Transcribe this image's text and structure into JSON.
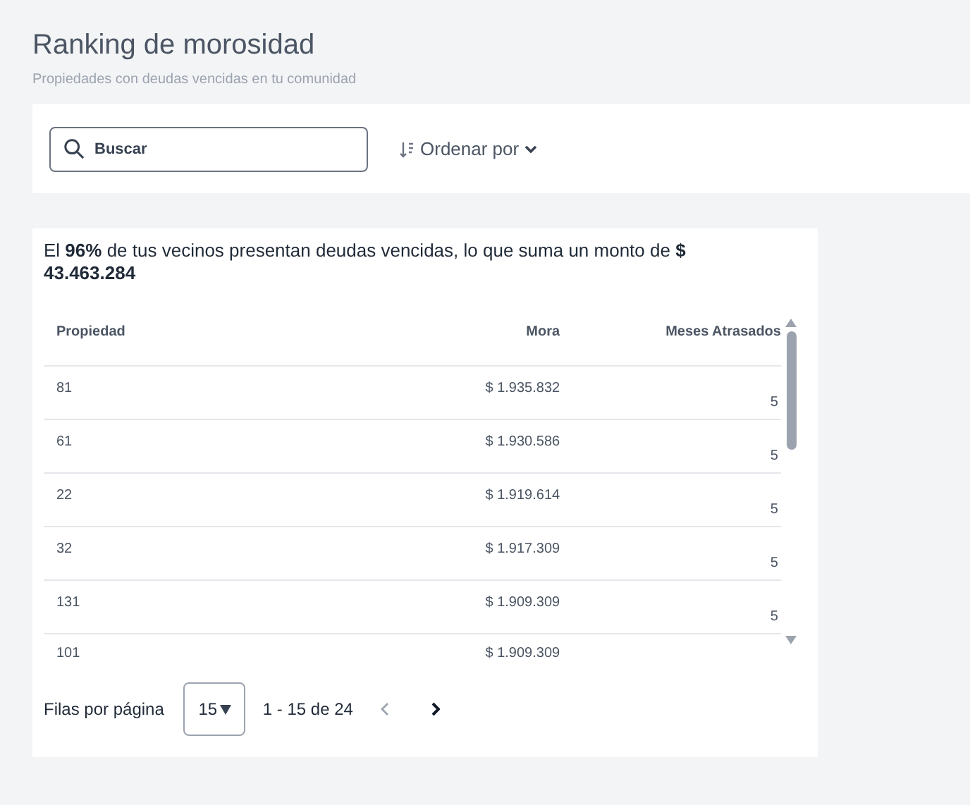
{
  "header": {
    "title": "Ranking de morosidad",
    "subtitle": "Propiedades con deudas vencidas en tu comunidad"
  },
  "toolbar": {
    "search": {
      "placeholder": "Buscar"
    },
    "sort_button": "Ordenar por"
  },
  "summary": "El **96%** de tus vecinos presentan deudas vencidas, lo que suma un monto de **$ 43.463.284**",
  "table": {
    "columns": [
      "Propiedad",
      "Mora",
      "Meses Atrasados"
    ],
    "rows": [
      {
        "propiedad": "81",
        "mora": "$ 1.935.832",
        "meses": "5"
      },
      {
        "propiedad": "61",
        "mora": "$ 1.930.586",
        "meses": "5"
      },
      {
        "propiedad": "22",
        "mora": "$ 1.919.614",
        "meses": "5"
      },
      {
        "propiedad": "32",
        "mora": "$ 1.917.309",
        "meses": "5"
      },
      {
        "propiedad": "131",
        "mora": "$ 1.909.309",
        "meses": "5"
      },
      {
        "propiedad": "101",
        "mora": "$ 1.909.309"
      }
    ]
  },
  "pagination": {
    "label": "Filas por página",
    "rows_per_page": "15",
    "range": "1 - 15 de 24",
    "prev": {
      "disabled": true
    },
    "next": {
      "disabled": false
    }
  }
}
